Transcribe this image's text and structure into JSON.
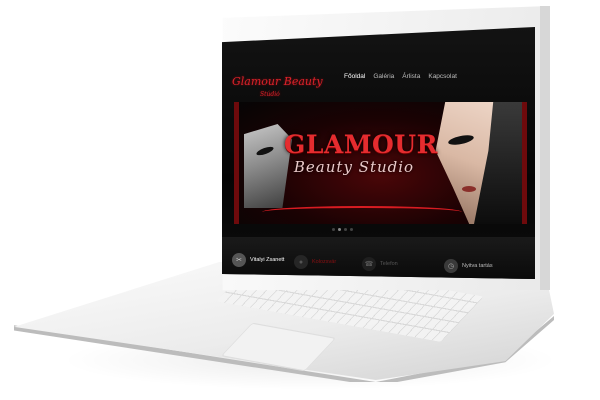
{
  "logo": {
    "name": "Glamour Beauty",
    "sub": "Stúdió"
  },
  "nav": {
    "items": [
      "Főoldal",
      "Galéria",
      "Árlista",
      "Kapcsolat"
    ],
    "active": 0
  },
  "banner": {
    "title": "GLAMOUR",
    "subtitle": "Beauty Studio"
  },
  "info": {
    "items": [
      {
        "icon": "scissors-icon",
        "label": "Vitalyi Zsanett"
      },
      {
        "icon": "location-icon",
        "label": "Kolozsvár"
      },
      {
        "icon": "phone-icon",
        "label": "Telefon"
      },
      {
        "icon": "clock-icon",
        "label": "Nyitva tartás"
      }
    ]
  },
  "colors": {
    "accent": "#d9222a",
    "screen_bg": "#0a0a0a",
    "laptop": "#eeeeee"
  }
}
